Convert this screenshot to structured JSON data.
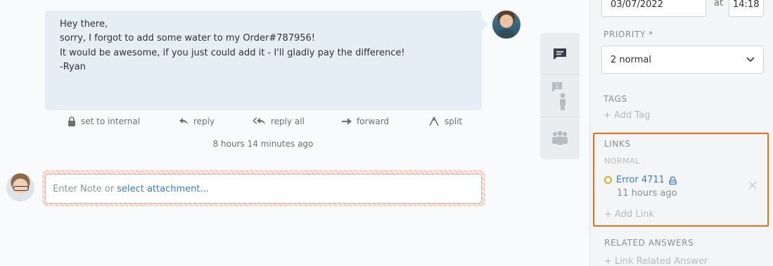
{
  "article": {
    "lines": [
      "Hey there,",
      "",
      "sorry, I forgot to add some water to my Order#787956!",
      "It would be awesome, if you just could add it - I'll gladly pay the difference!",
      "",
      "-Ryan"
    ],
    "actions": {
      "set_internal": "set to internal",
      "reply": "reply",
      "reply_all": "reply all",
      "forward": "forward",
      "split": "split"
    },
    "timestamp": "8 hours 14 minutes ago"
  },
  "composer": {
    "placeholder": "Enter Note or",
    "attachment_link": "select attachment..."
  },
  "sidebar": {
    "pending_date": "03/07/2022",
    "at_label": "at",
    "pending_time": "14:18",
    "priority_label": "PRIORITY *",
    "priority_value": "2 normal",
    "tags_label": "TAGS",
    "add_tag": "+ Add Tag",
    "links_label": "LINKS",
    "links_type": "NORMAL",
    "link_items": [
      {
        "title": "Error 4711",
        "age": "11 hours ago"
      }
    ],
    "add_link": "+ Add Link",
    "related_label": "RELATED ANSWERS",
    "add_related": "+ Link Related Answer"
  },
  "colors": {
    "accent": "#3a7dc1",
    "highlight": "#ef6c1a",
    "status_pending": "#e4a829"
  },
  "icons": {
    "tabs": [
      "chat-icon",
      "customer-icon",
      "group-icon"
    ],
    "link_status": "status-circle-icon",
    "link_lock": "lock-icon"
  }
}
